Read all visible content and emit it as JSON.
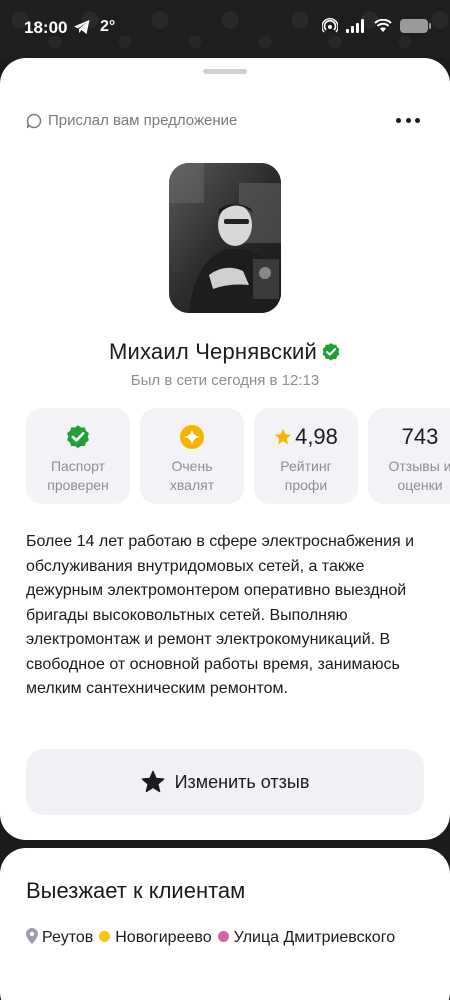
{
  "status_bar": {
    "time": "18:00",
    "temperature": "2°",
    "icons": [
      "telegram-icon",
      "hotspot-icon",
      "signal-icon",
      "wifi-icon",
      "battery-charging-icon"
    ]
  },
  "header": {
    "offer_text": "Прислал вам предложение"
  },
  "profile": {
    "name": "Михаил Чернявский",
    "last_seen": "Был в сети сегодня в 12:13"
  },
  "stats": [
    {
      "icon": "verified-check-icon",
      "label": "Паспорт проверен",
      "color": "#21a038"
    },
    {
      "icon": "sparkle-icon",
      "label": "Очень хвалят",
      "color": "#f5b400"
    },
    {
      "value": "4,98",
      "label": "Рейтинг профи",
      "icon": "star-icon",
      "color": "#f5b400"
    },
    {
      "value": "743",
      "label": "Отзывы и оценки"
    }
  ],
  "about": "Более 14 лет работаю в сфере электроснабжения и обслуживания внутридомовых сетей, а также дежурным электромонтером оперативно выездной бригады высоковольтных сетей. Выполняю электромонтаж и ремонт электрокомуникаций. В свободное от основной работы время, занимаюсь мелким сантехническим ремонтом.",
  "actions": {
    "edit_review_label": "Изменить отзыв"
  },
  "travel": {
    "title": "Выезжает к клиентам",
    "locations": [
      {
        "name": "Реутов",
        "color": "#9aa0a8"
      },
      {
        "name": "Новогиреево",
        "color": "#f5c518"
      },
      {
        "name": "Улица Дмитриевского",
        "color": "#d663a6"
      }
    ]
  }
}
